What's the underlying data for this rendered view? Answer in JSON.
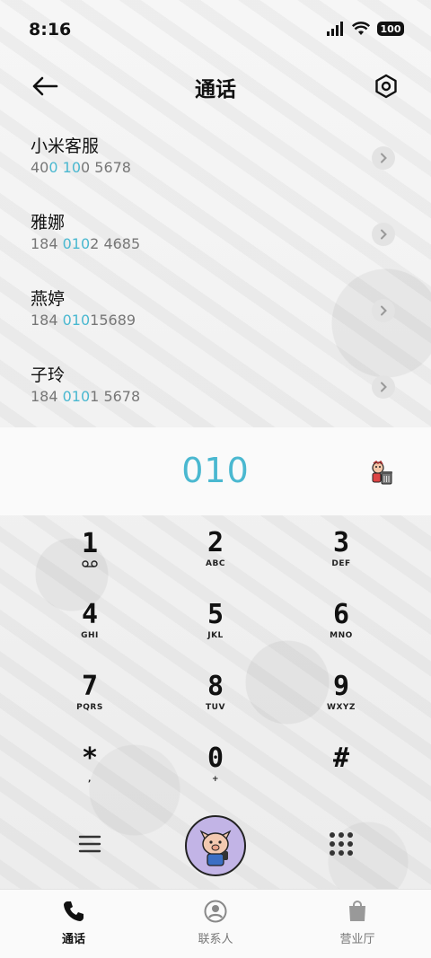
{
  "status_bar": {
    "time": "8:16",
    "battery": "100"
  },
  "header": {
    "title": "通话"
  },
  "contacts": [
    {
      "name": "小米客服",
      "number_parts": [
        {
          "t": "40",
          "h": false
        },
        {
          "t": "0",
          "h": true
        },
        {
          "t": " ",
          "h": false
        },
        {
          "t": "10",
          "h": true
        },
        {
          "t": "0 5678",
          "h": false
        }
      ]
    },
    {
      "name": "雅娜",
      "number_parts": [
        {
          "t": "184 ",
          "h": false
        },
        {
          "t": "010",
          "h": true
        },
        {
          "t": "2 4685",
          "h": false
        }
      ]
    },
    {
      "name": "燕婷",
      "number_parts": [
        {
          "t": "184 ",
          "h": false
        },
        {
          "t": "010",
          "h": true
        },
        {
          "t": "15689",
          "h": false
        }
      ]
    },
    {
      "name": "子玲",
      "number_parts": [
        {
          "t": "184 ",
          "h": false
        },
        {
          "t": "010",
          "h": true
        },
        {
          "t": "1 5678",
          "h": false
        }
      ]
    }
  ],
  "dial": {
    "number": "010"
  },
  "keypad": {
    "keys": [
      {
        "digit": "1",
        "letters": "voicemail-icon",
        "icon": true
      },
      {
        "digit": "2",
        "letters": "ABC"
      },
      {
        "digit": "3",
        "letters": "DEF"
      },
      {
        "digit": "4",
        "letters": "GHI"
      },
      {
        "digit": "5",
        "letters": "JKL"
      },
      {
        "digit": "6",
        "letters": "MNO"
      },
      {
        "digit": "7",
        "letters": "PQRS"
      },
      {
        "digit": "8",
        "letters": "TUV"
      },
      {
        "digit": "9",
        "letters": "WXYZ"
      },
      {
        "digit": "*",
        "letters": ","
      },
      {
        "digit": "0",
        "letters": "+"
      },
      {
        "digit": "#",
        "letters": ""
      }
    ]
  },
  "bottom_nav": {
    "items": [
      {
        "label": "通话",
        "icon": "phone-icon",
        "active": true
      },
      {
        "label": "联系人",
        "icon": "contacts-icon",
        "active": false
      },
      {
        "label": "营业厅",
        "icon": "shopping-bag-icon",
        "active": false
      }
    ]
  },
  "colors": {
    "accent": "#4ab8d0",
    "call_button": "#c2b4e6"
  }
}
